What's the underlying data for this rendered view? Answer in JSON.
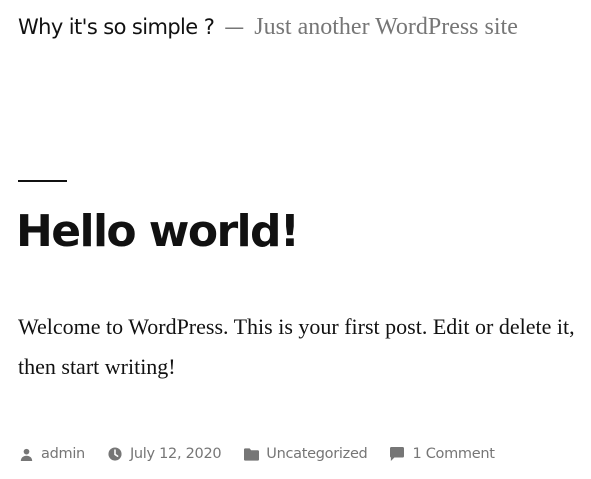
{
  "header": {
    "site_title": "Why it's so simple ?",
    "separator": "—",
    "tagline": "Just another WordPress site"
  },
  "post": {
    "title": "Hello world!",
    "content": "Welcome to WordPress. This is your first post. Edit or delete it, then start writing!",
    "meta": {
      "author": "admin",
      "date": "July 12, 2020",
      "category": "Uncategorized",
      "comments": "1 Comment"
    }
  },
  "icons": {
    "author": "person-icon",
    "date": "clock-icon",
    "category": "folder-icon",
    "comments": "comment-icon"
  },
  "colors": {
    "text": "#111111",
    "muted": "#767676",
    "background": "#ffffff"
  }
}
